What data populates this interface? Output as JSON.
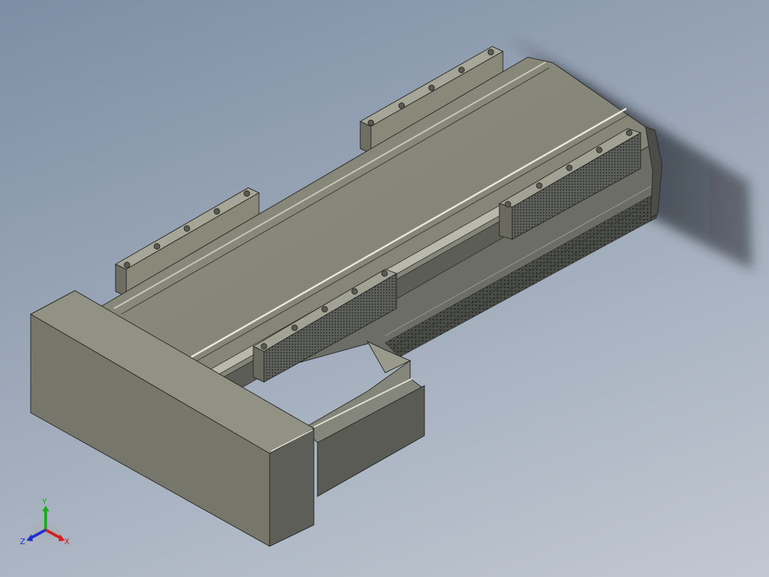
{
  "view": {
    "background_top": "#7d8ea4",
    "background_bottom": "#c2c8d2",
    "model_color": "#8a8a7c",
    "edge_color": "#2a2a26"
  },
  "triad": {
    "x_label": "X",
    "y_label": "Y",
    "z_label": "Z",
    "x_color": "#d02020",
    "y_color": "#18b018",
    "z_color": "#2030d0"
  }
}
